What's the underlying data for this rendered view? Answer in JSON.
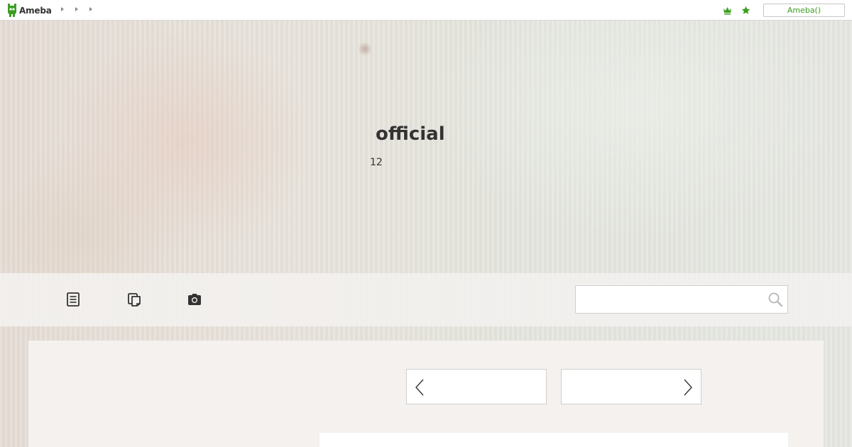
{
  "topbar": {
    "logo_text": "Ameba",
    "breadcrumbs": [
      "",
      "",
      ""
    ],
    "login_label": "Ameba()"
  },
  "header": {
    "title": "official",
    "subtitle": "12"
  },
  "nav": {
    "items": [
      {
        "icon": "article-list-icon"
      },
      {
        "icon": "theme-pages-icon"
      },
      {
        "icon": "camera-icon"
      }
    ],
    "search": {
      "value": "",
      "placeholder": ""
    }
  },
  "pager": {
    "prev_label": "",
    "next_label": ""
  },
  "colors": {
    "brand_green": "#3a9e21",
    "text": "#333333",
    "border": "#cfcfcf"
  }
}
